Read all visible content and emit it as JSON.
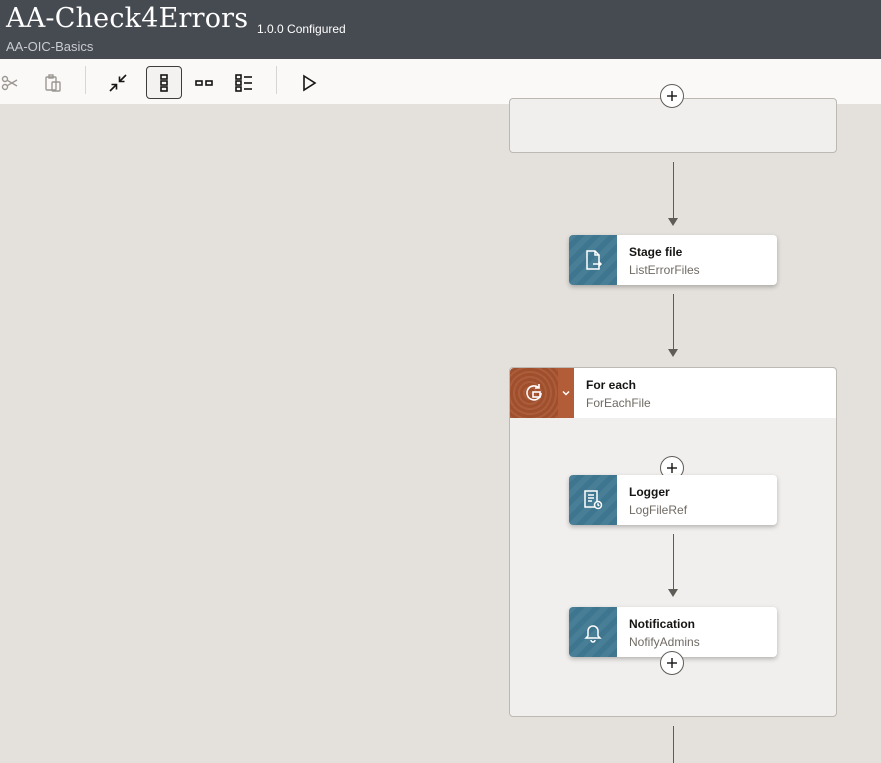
{
  "header": {
    "title": "AA-Check4Errors",
    "version": "1.0.0 Configured",
    "subtitle": "AA-OIC-Basics",
    "background": "#464a51"
  },
  "toolbar": {
    "buttons": [
      {
        "icon": "scissors-icon",
        "enabled": false
      },
      {
        "icon": "paste-icon",
        "enabled": false
      },
      {
        "icon": "collapse-icon",
        "enabled": true
      },
      {
        "icon": "vertical-layout-icon",
        "enabled": true,
        "selected": true
      },
      {
        "icon": "horizontal-layout-icon",
        "enabled": true
      },
      {
        "icon": "pseudo-view-icon",
        "enabled": true
      },
      {
        "icon": "play-icon",
        "enabled": true
      }
    ]
  },
  "flow": {
    "stage_file": {
      "title": "Stage file",
      "subtitle": "ListErrorFiles",
      "icon": "stage-file-icon"
    },
    "for_each": {
      "title": "For each",
      "subtitle": "ForEachFile",
      "icon": "loop-icon"
    },
    "logger": {
      "title": "Logger",
      "subtitle": "LogFileRef",
      "icon": "logger-icon"
    },
    "notification": {
      "title": "Notification",
      "subtitle": "NofifyAdmins",
      "icon": "bell-icon"
    }
  },
  "colors": {
    "canvas": "#e4e1dc",
    "action_icon": "#3e7690",
    "for_each_icon": "#a6522f"
  }
}
